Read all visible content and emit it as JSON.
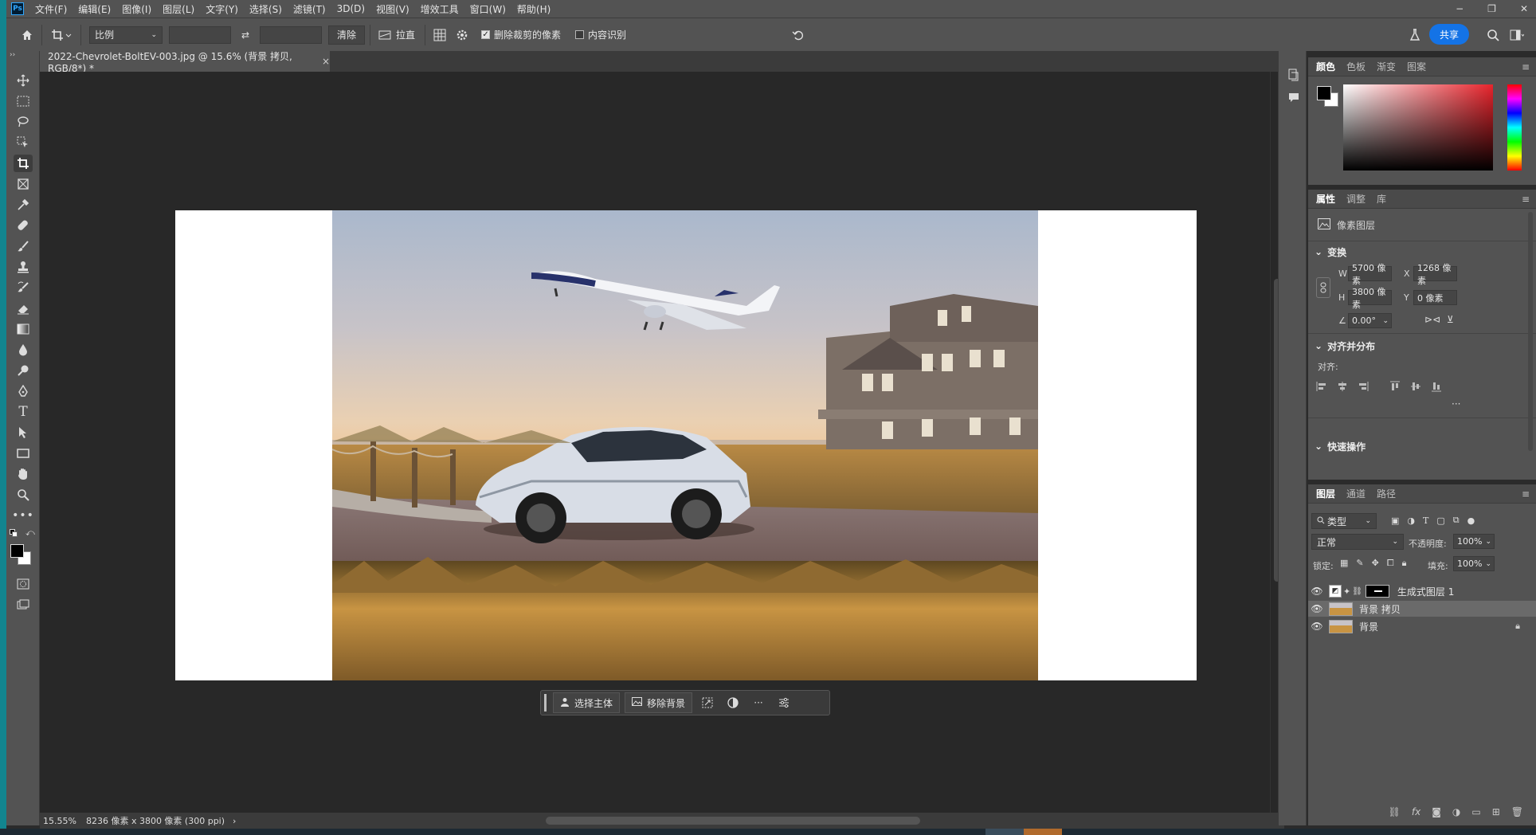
{
  "app": {
    "logo": "Ps"
  },
  "menu": [
    "文件(F)",
    "编辑(E)",
    "图像(I)",
    "图层(L)",
    "文字(Y)",
    "选择(S)",
    "滤镜(T)",
    "3D(D)",
    "视图(V)",
    "增效工具",
    "窗口(W)",
    "帮助(H)"
  ],
  "window_controls": {
    "minimize": "−",
    "restore": "❐",
    "close": "✕"
  },
  "options": {
    "ratio_value": "比例",
    "swap_icon": "⇄",
    "clear_label": "清除",
    "straighten_label": "拉直",
    "delete_cropped_label": "删除裁剪的像素",
    "delete_cropped_checked": true,
    "content_aware_label": "内容识别",
    "content_aware_checked": false,
    "share_label": "共享"
  },
  "document": {
    "tab_title": "2022-Chevrolet-BoltEV-003.jpg @ 15.6% (背景 拷贝, RGB/8*) *",
    "tab_close": "×"
  },
  "context_bar": {
    "select_subject": "选择主体",
    "remove_background": "移除背景",
    "more": "···"
  },
  "status": {
    "zoom": "15.55%",
    "doc_info": "8236 像素 x 3800 像素 (300 ppi)",
    "arrow": "›"
  },
  "color_panel": {
    "tabs": [
      "颜色",
      "色板",
      "渐变",
      "图案"
    ],
    "foreground": "#000000",
    "background": "#ffffff",
    "hue": "#e8242c"
  },
  "properties": {
    "tabs": [
      "属性",
      "调整",
      "库"
    ],
    "layer_type": "像素图层",
    "transform_title": "变换",
    "w_label": "W",
    "w_value": "5700 像素",
    "h_label": "H",
    "h_value": "3800 像素",
    "x_label": "X",
    "x_value": "1268 像素",
    "y_label": "Y",
    "y_value": "0 像素",
    "angle_value": "0.00°",
    "align_title": "对齐并分布",
    "align_label": "对齐:",
    "more": "···",
    "quick_actions_title": "快速操作"
  },
  "layers": {
    "tabs": [
      "图层",
      "通道",
      "路径"
    ],
    "filter_kind": "类型",
    "blend_mode": "正常",
    "opacity_label": "不透明度:",
    "opacity_value": "100%",
    "lock_label": "锁定:",
    "fill_label": "填充:",
    "fill_value": "100%",
    "items": [
      {
        "name": "生成式图层 1",
        "visible": true,
        "selected": false,
        "locked": false
      },
      {
        "name": "背景 拷贝",
        "visible": true,
        "selected": true,
        "locked": false
      },
      {
        "name": "背景",
        "visible": true,
        "selected": false,
        "locked": true
      }
    ],
    "bottom_icons": [
      "link-icon",
      "fx-icon",
      "mask-icon",
      "adjustment-icon",
      "group-icon",
      "new-layer-icon",
      "trash-icon"
    ],
    "fx_label": "fx"
  }
}
